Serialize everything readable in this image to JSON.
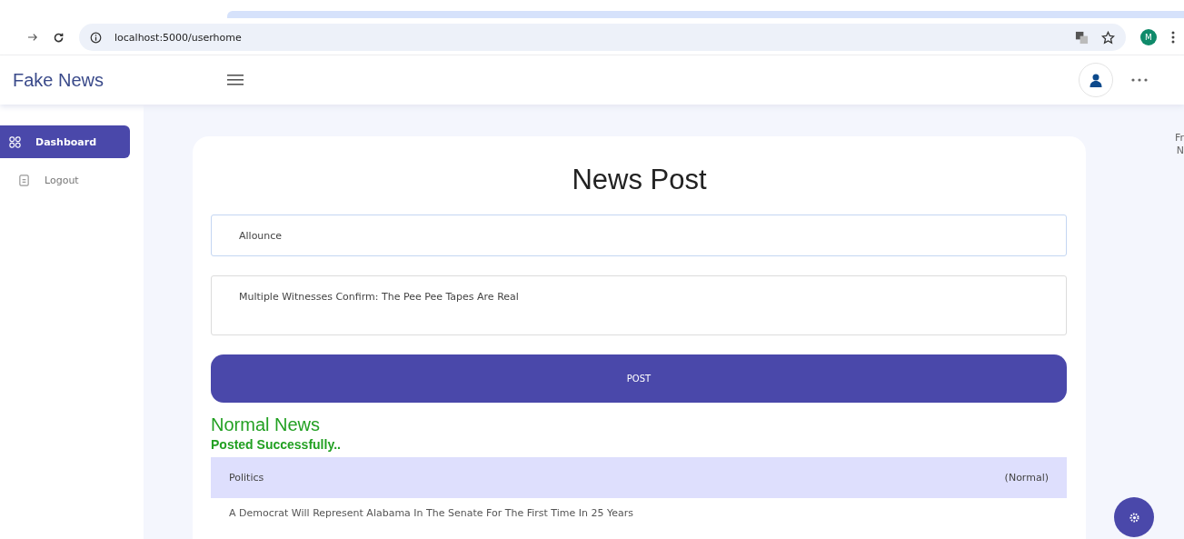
{
  "browser": {
    "url": "localhost:5000/userhome",
    "profile_initial": "M"
  },
  "app": {
    "title": "Fake News"
  },
  "sidebar": {
    "items": [
      {
        "label": "Dashboard",
        "selected": true,
        "kind": "grid"
      },
      {
        "label": "Logout",
        "kind": "doc",
        "selected": false
      }
    ]
  },
  "form": {
    "title": "News Post",
    "fields": [
      {
        "value": "Allounce"
      },
      {
        "value": "Multiple Witnesses Confirm: The Pee Pee Tapes Are Real"
      }
    ],
    "submit": "POST"
  },
  "result": {
    "label": "Normal News",
    "message": "Posted Successfully.."
  },
  "table": {
    "header": {
      "category": "Politics",
      "status": "(Normal)"
    },
    "rows": [
      {
        "headline": "A Democrat Will Represent Alabama In The Senate For The First Time In 25 Years"
      }
    ]
  },
  "right_panel": {
    "lines": [
      "Fr",
      "N"
    ]
  }
}
